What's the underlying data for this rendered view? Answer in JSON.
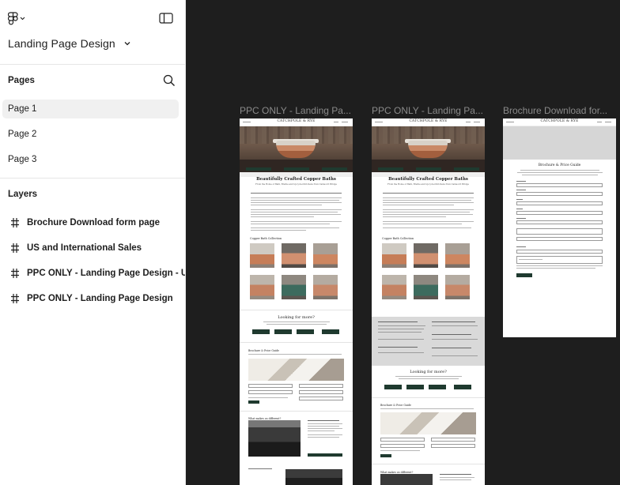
{
  "app": {
    "file_name": "Landing Page Design"
  },
  "sidebar": {
    "pages_title": "Pages",
    "pages": [
      {
        "label": "Page 1",
        "active": true
      },
      {
        "label": "Page 2",
        "active": false
      },
      {
        "label": "Page 3",
        "active": false
      }
    ],
    "layers_title": "Layers",
    "layers": [
      {
        "label": "Brochure Download form page"
      },
      {
        "label": "US and International Sales"
      },
      {
        "label": "PPC ONLY - Landing Page Design - US"
      },
      {
        "label": "PPC ONLY - Landing Page Design"
      }
    ]
  },
  "canvas": {
    "frames": [
      {
        "label": "PPC ONLY - Landing Pa...",
        "brand": "CATCHPOLE & RYE",
        "heading": "Beautifully Crafted Copper Baths",
        "subheading": "From the Home of Bath, Brethe and Upcycled Kitchens from Caldecott Bridge",
        "collection_title": "Copper Bath Collection",
        "looking_title": "Looking for more?",
        "guide_title": "Brochure & Price Guide",
        "difference_title": "What makes us different?",
        "colors": {
          "button": "#1f3a2f",
          "copper": "#c98966"
        }
      },
      {
        "label": "PPC ONLY - Landing Pa...",
        "brand": "CATCHPOLE & RYE",
        "heading": "Beautifully Crafted Copper Baths",
        "subheading": "From the Home of Bath, Brethe and Upcycled Kitchens from Caldecott Bridge",
        "collection_title": "Copper Bath Collection",
        "looking_title": "Looking for more?",
        "guide_title": "Brochure & Price Guide",
        "difference_title": "What makes us different?"
      },
      {
        "label": "Brochure Download for...",
        "brand": "CATCHPOLE & RYE",
        "heading": "Brochure & Price Guide",
        "fields": [
          "First Name",
          "Last Name",
          "Email",
          "Phone",
          "Address",
          "Post Code",
          "Country"
        ]
      }
    ]
  },
  "icons": {
    "menu": "figma-logo-icon",
    "panel": "sidebar-panel-icon",
    "search": "search-icon",
    "frame": "frame-hash-icon"
  }
}
